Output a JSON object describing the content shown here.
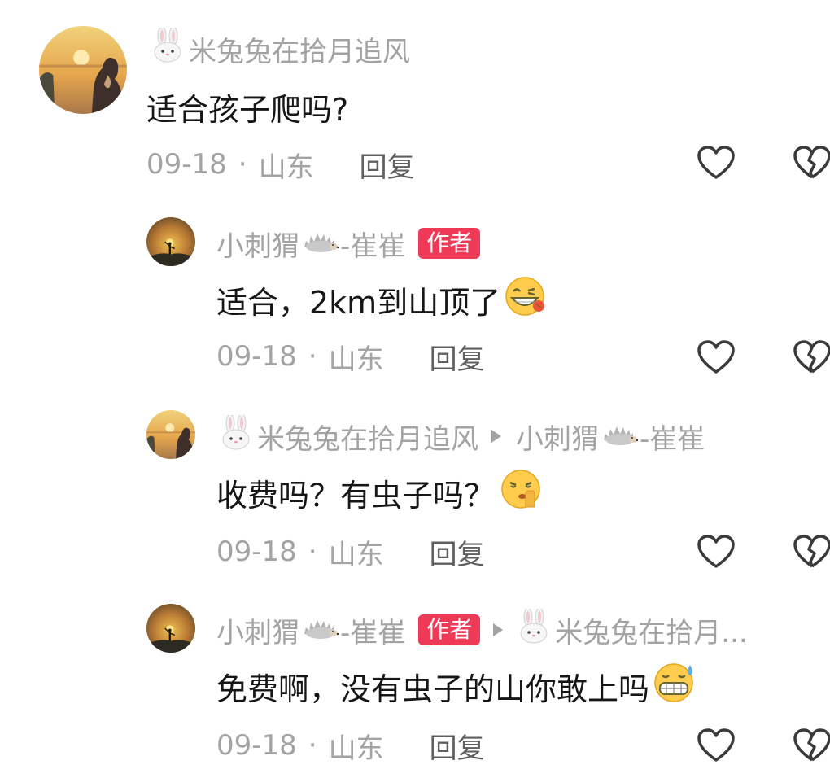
{
  "comments": [
    {
      "username": "米兔兔在拾月追风",
      "content": "适合孩子爬吗?",
      "date": "09-18",
      "separator": "·",
      "location": "山东",
      "reply_label": "回复",
      "icons": [
        "rabbit-icon",
        "heart-icon",
        "broken-heart-icon"
      ]
    },
    {
      "username": "小刺猬",
      "username_suffix": "-崔崔",
      "author_badge": "作者",
      "content": "适合，2km到山顶了",
      "date": "09-18",
      "separator": "·",
      "location": "山东",
      "reply_label": "回复",
      "icons": [
        "hedgehog-icon",
        "grinning-emoji-icon",
        "heart-icon",
        "broken-heart-icon"
      ]
    },
    {
      "username": "米兔兔在拾月追风",
      "reply_to": "小刺猬",
      "reply_to_suffix": "-崔崔",
      "content": "收费吗？有虫子吗？",
      "date": "09-18",
      "separator": "·",
      "location": "山东",
      "reply_label": "回复",
      "icons": [
        "rabbit-icon",
        "hedgehog-icon",
        "shushing-emoji-icon",
        "heart-icon",
        "broken-heart-icon"
      ]
    },
    {
      "username": "小刺猬",
      "username_suffix": "-崔崔",
      "author_badge": "作者",
      "reply_to": "米兔兔在拾月...",
      "content": "免费啊，没有虫子的山你敢上吗",
      "date": "09-18",
      "separator": "·",
      "location": "山东",
      "reply_label": "回复",
      "icons": [
        "hedgehog-icon",
        "rabbit-icon",
        "grimacing-sweat-emoji-icon",
        "heart-icon",
        "broken-heart-icon"
      ]
    }
  ],
  "colors": {
    "username": "#a3a3a3",
    "content": "#161616",
    "badge": "#ef3a57",
    "icon_stroke": "#3a3a3a"
  }
}
